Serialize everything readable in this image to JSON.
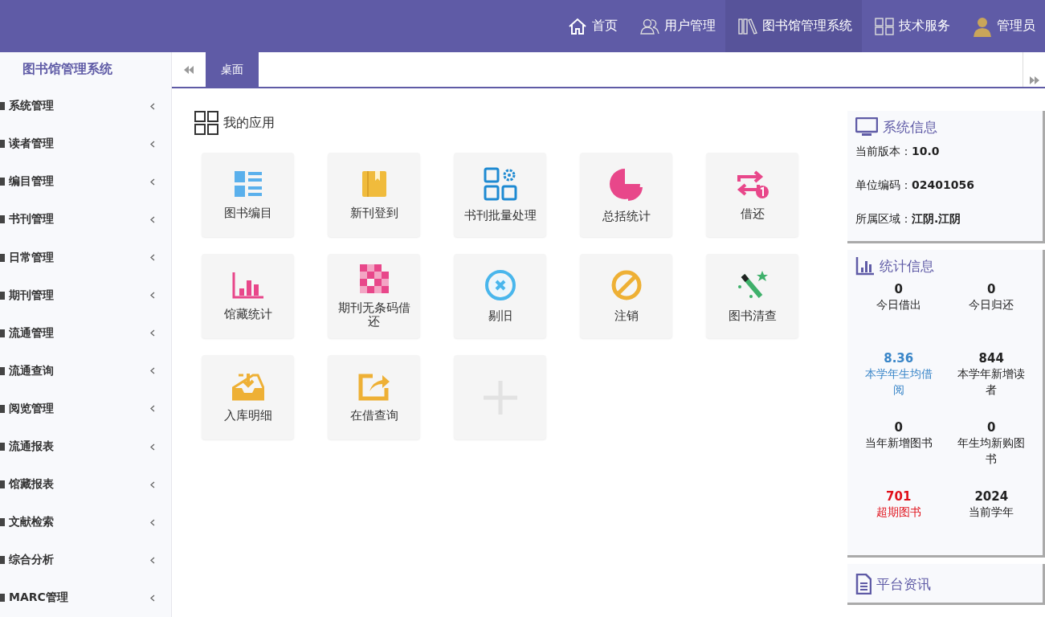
{
  "top_nav": [
    {
      "label": "首页",
      "kind": "home",
      "selected": false
    },
    {
      "label": "用户管理",
      "kind": "users",
      "selected": false
    },
    {
      "label": "图书馆管理系统",
      "kind": "books",
      "selected": true
    },
    {
      "label": "技术服务",
      "kind": "grid",
      "selected": false
    },
    {
      "label": "管理员",
      "kind": "avatar",
      "selected": false
    }
  ],
  "sidebar": {
    "title": "图书馆管理系统",
    "items": [
      {
        "label": "系统管理"
      },
      {
        "label": "读者管理"
      },
      {
        "label": "编目管理"
      },
      {
        "label": "书刊管理"
      },
      {
        "label": "日常管理"
      },
      {
        "label": "期刊管理"
      },
      {
        "label": "流通管理"
      },
      {
        "label": "流通查询"
      },
      {
        "label": "阅览管理"
      },
      {
        "label": "流通报表"
      },
      {
        "label": "馆藏报表"
      },
      {
        "label": "文献检索"
      },
      {
        "label": "综合分析"
      },
      {
        "label": "MARC管理"
      }
    ]
  },
  "tabs": [
    {
      "label": "桌面",
      "selected": true
    }
  ],
  "apps_title": "我的应用",
  "apps": [
    {
      "kind": "list",
      "label": "图书编目"
    },
    {
      "kind": "book",
      "label": "新刊登到"
    },
    {
      "kind": "blocks",
      "label": "书刊批量处理"
    },
    {
      "kind": "pie",
      "label": "总括统计"
    },
    {
      "kind": "swap",
      "label": "借还"
    },
    {
      "kind": "bars",
      "label": "馆藏统计"
    },
    {
      "kind": "checker",
      "label": "期刊无条码借还"
    },
    {
      "kind": "cancel",
      "label": "剔旧"
    },
    {
      "kind": "forbid",
      "label": "注销"
    },
    {
      "kind": "wand",
      "label": "图书清查"
    },
    {
      "kind": "inbox",
      "label": "入库明细"
    },
    {
      "kind": "share",
      "label": "在借查询"
    },
    {
      "kind": "add"
    }
  ],
  "system_info": {
    "title": "系统信息",
    "rows": [
      {
        "label": "当前版本：",
        "value": "10.0"
      },
      {
        "label": "单位编码：",
        "value": "02401056"
      },
      {
        "label": "所属区域：",
        "value": "江阴.江阴"
      }
    ]
  },
  "stats": {
    "title": "统计信息",
    "items": [
      {
        "value": "0",
        "label": "今日借出",
        "color": "#222222"
      },
      {
        "value": "0",
        "label": "今日归还",
        "color": "#222222"
      },
      {
        "value": "8.36",
        "label": "本学年生均借阅",
        "color": "#3a86c8"
      },
      {
        "value": "844",
        "label": "本学年新增读者",
        "color": "#222222"
      },
      {
        "value": "0",
        "label": "当年新增图书",
        "color": "#222222"
      },
      {
        "value": "0",
        "label": "年生均新购图书",
        "color": "#222222"
      },
      {
        "value": "701",
        "label": "超期图书",
        "color": "#e0101a"
      },
      {
        "value": "2024",
        "label": "当前学年",
        "color": "#222222"
      }
    ]
  },
  "news": {
    "title": "平台资讯"
  }
}
